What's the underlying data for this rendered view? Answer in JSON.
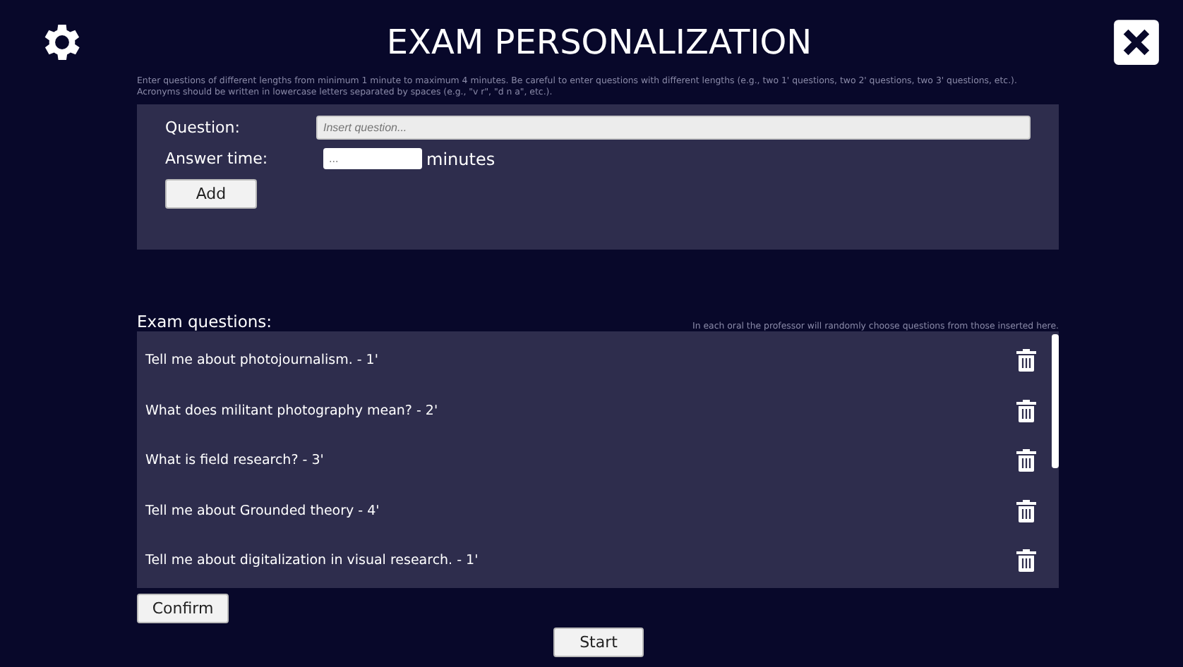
{
  "title": "EXAM PERSONALIZATION",
  "instructions": "Enter questions of different lengths from minimum 1 minute to maximum 4 minutes. Be careful to enter questions with different lengths (e.g., two 1' questions, two 2' questions, two 3' questions, etc.). Acronyms should be written in lowercase letters separated by spaces (e.g., \"v r\", \"d n a\", etc.).",
  "form": {
    "question_label": "Question:",
    "question_placeholder": "Insert question...",
    "time_label": "Answer time:",
    "time_placeholder": "...",
    "time_unit": "minutes",
    "add_button": "Add"
  },
  "questions_title": "Exam questions:",
  "questions_note": "In each oral the professor will randomly choose questions from those inserted here.",
  "questions": [
    {
      "text": "Tell me about photojournalism. - 1'"
    },
    {
      "text": "What does militant photography mean? - 2'"
    },
    {
      "text": "What is field research? - 3'"
    },
    {
      "text": "Tell me about Grounded theory - 4'"
    },
    {
      "text": "Tell me about digitalization in visual research. - 1'"
    }
  ],
  "confirm_button": "Confirm",
  "start_button": "Start"
}
